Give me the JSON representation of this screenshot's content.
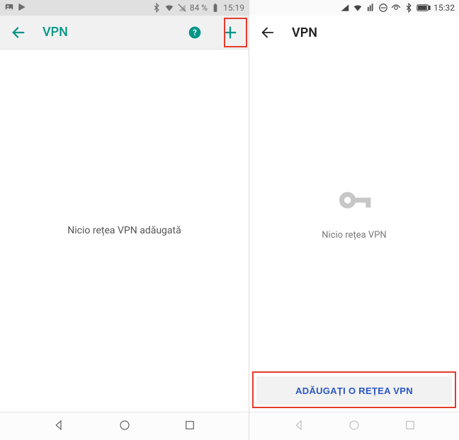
{
  "left": {
    "status": {
      "battery_pct": "84 %",
      "time": "15:19"
    },
    "title": "VPN",
    "empty_message": "Nicio rețea VPN adăugată"
  },
  "right": {
    "status": {
      "time": "15:32"
    },
    "title": "VPN",
    "empty_message": "Nicio rețea VPN",
    "add_button_label": "ADĂUGAȚI O REȚEA VPN"
  }
}
